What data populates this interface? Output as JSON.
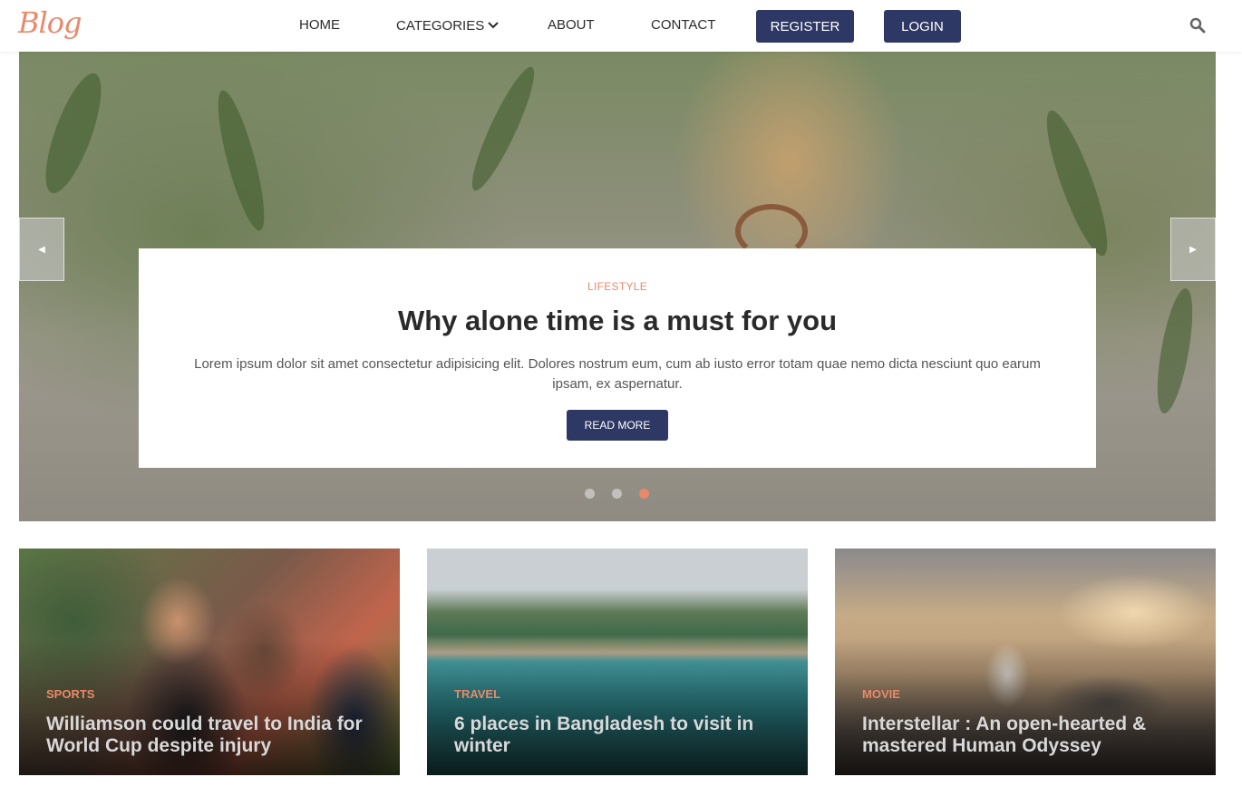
{
  "header": {
    "logo": "Blog",
    "nav": {
      "home": "HOME",
      "categories": "CATEGORIES",
      "about": "ABOUT",
      "contact": "CONTACT"
    },
    "register": "REGISTER",
    "login": "LOGIN",
    "search_icon": "search-icon"
  },
  "hero": {
    "category": "LIFESTYLE",
    "title": "Why alone time is a must for you",
    "text": "Lorem ipsum dolor sit amet consectetur adipisicing elit. Dolores nostrum eum, cum ab iusto error totam quae nemo dicta nesciunt quo earum ipsam, ex aspernatur.",
    "read_more": "READ MORE",
    "slides_total": 3,
    "active_slide": 3
  },
  "cards": [
    {
      "category": "SPORTS",
      "title": "Williamson could travel to India for World Cup despite injury"
    },
    {
      "category": "TRAVEL",
      "title": "6 places in Bangladesh to visit in winter"
    },
    {
      "category": "MOVIE",
      "title": "Interstellar : An open-hearted & mastered Human Odyssey"
    }
  ],
  "colors": {
    "accent": "#e8896a",
    "primary": "#2e3864"
  }
}
